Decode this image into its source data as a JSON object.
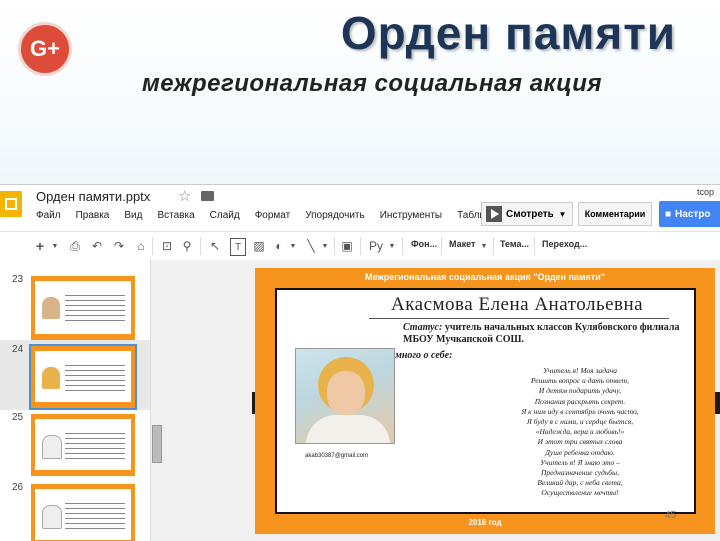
{
  "header": {
    "gplus_label": "G+",
    "title": "Орден памяти",
    "subtitle": "межрегиональная социальная акция"
  },
  "app": {
    "doc_title": "Орден памяти.pptx",
    "user_email": "tcop",
    "menu": [
      "Файл",
      "Правка",
      "Вид",
      "Вставка",
      "Слайд",
      "Формат",
      "Упорядочить",
      "Инструменты",
      "Табли"
    ],
    "present_label": "Смотреть",
    "comments_label": "Комментарии",
    "share_label": "Настро",
    "toolbar": {
      "font_label": "Фон...",
      "layout_label": "Макет",
      "theme_label": "Тема...",
      "transition_label": "Переход..."
    }
  },
  "slides_panel": {
    "slide_numbers": [
      "23",
      "24",
      "25",
      "26"
    ],
    "selected": "24"
  },
  "slide": {
    "header": "Межрегиональная социальная акция \"Орден памяти\"",
    "name": "Акасмова Елена Анатольевна",
    "status_label": "Статус:",
    "status_text": "учитель начальных классов Кулябовского филиала МБОУ Мучкапской СОШ.",
    "about_label": "Немного о себе:",
    "email": "akab30387@gmail.com",
    "poem": [
      "Учитель я! Моя задача",
      "Решить вопрос и дать ответ,",
      "И детям подарить удачу,",
      "Познания раскрыть секрет.",
      "Я к ним иду в сентябрь очень часто,",
      "Я буду я с ними, и сердце бьется,",
      "«Надежда, вера и любовь!»",
      "И этот три святых слова",
      "Душе ребенка отдаю.",
      "Учитель я! Я знаю это –",
      "Предназначение судьбы,",
      "Великий дар, с неба света,",
      "Осуществление мечты!"
    ],
    "footer": "2016 год",
    "page_number": "45"
  }
}
